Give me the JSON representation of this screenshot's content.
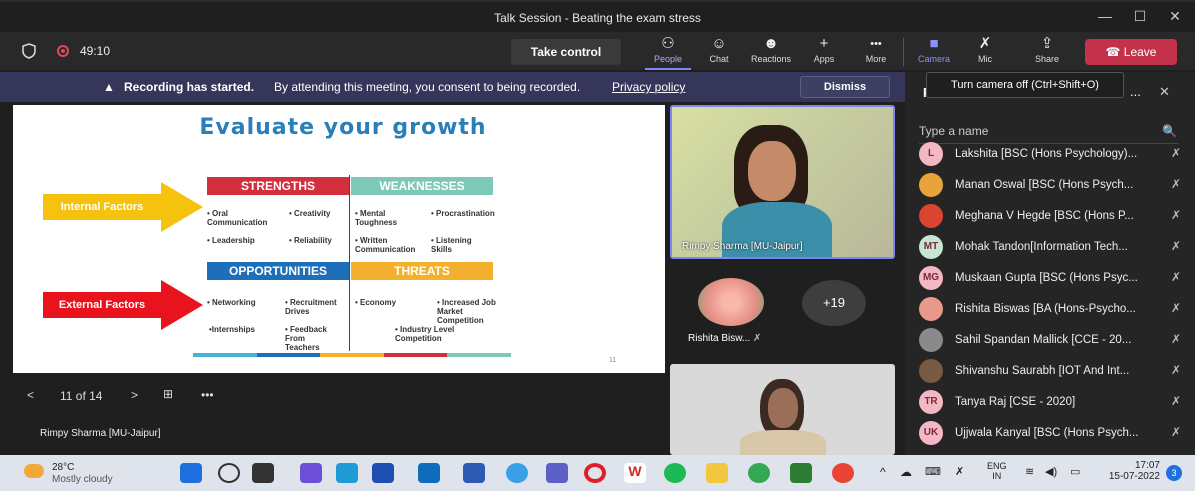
{
  "window": {
    "title": "Talk Session - Beating the exam stress",
    "min": "—",
    "max": "☐",
    "close": "✕"
  },
  "toolbar": {
    "timer": "49:10",
    "take_control": "Take control",
    "items": [
      {
        "label": "People",
        "icon": "people-icon",
        "glyph": "⚇"
      },
      {
        "label": "Chat",
        "icon": "chat-icon",
        "glyph": "☺"
      },
      {
        "label": "Reactions",
        "icon": "reactions-icon",
        "glyph": "☻"
      },
      {
        "label": "Apps",
        "icon": "apps-icon",
        "glyph": "+"
      },
      {
        "label": "More",
        "icon": "more-icon",
        "glyph": "•••"
      },
      {
        "label": "Camera",
        "icon": "camera-icon",
        "glyph": "■"
      },
      {
        "label": "Mic",
        "icon": "mic-off-icon",
        "glyph": "✗"
      },
      {
        "label": "Share",
        "icon": "share-icon",
        "glyph": "⇪"
      }
    ],
    "leave": "Leave",
    "camera_tooltip": "Turn camera off (Ctrl+Shift+O)"
  },
  "banner": {
    "bold": "Recording has started.",
    "text": "By attending this meeting, you consent to being recorded.",
    "link": "Privacy policy",
    "dismiss": "Dismiss"
  },
  "slide": {
    "title": "Evaluate your growth",
    "internal": "Internal Factors",
    "external": "External Factors",
    "strengths": "STRENGTHS",
    "weaknesses": "WEAKNESSES",
    "opportunities": "OPPORTUNITIES",
    "threats": "THREATS",
    "s1": "• Oral\nCommunication",
    "s2": "• Creativity",
    "s3": "• Leadership",
    "s4": "• Reliability",
    "w1": "• Mental\nToughness",
    "w2": "• Procrastination",
    "w3": "• Written\nCommunication",
    "w4": "• Listening\nSkills",
    "o1": "• Networking",
    "o2": "• Recruitment\nDrives",
    "o3": "•Internships",
    "o4": "• Feedback\nFrom\nTeachers",
    "t1": "• Economy",
    "t2": "• Increased Job\nMarket\nCompetition",
    "t3": "• Industry Level\nCompetition",
    "page_no": "11",
    "colors": {
      "strengths": "#d32f3c",
      "weaknesses": "#7ec8b8",
      "opportunities": "#1e6fb8",
      "threats": "#f2b02d"
    }
  },
  "slide_nav": {
    "counter": "11 of 14",
    "prev": "<",
    "next": ">",
    "more": "•••",
    "presenter": "Rimpy Sharma [MU-Jaipur]"
  },
  "videos": {
    "main_name": "Rimpy Sharma [MU-Jaipur]",
    "rishita": "Rishita Bisw...",
    "overflow": "+19"
  },
  "panel": {
    "header_initial": "P",
    "more": "...",
    "close": "✕",
    "search_placeholder": "Type a name",
    "participants": [
      {
        "name": "Lakshita [BSC (Hons Psychology)...",
        "initials": "L",
        "color": "#f4b8c4"
      },
      {
        "name": "Manan Oswal [BSC (Hons Psych...",
        "initials": "",
        "color": "#e8a43a"
      },
      {
        "name": "Meghana V Hegde [BSC (Hons P...",
        "initials": "",
        "color": "#d9452f"
      },
      {
        "name": "Mohak Tandon[Information Tech...",
        "initials": "MT",
        "color": "#c7e6d2"
      },
      {
        "name": "Muskaan Gupta [BSC (Hons Psyc...",
        "initials": "MG",
        "color": "#f4b8c4"
      },
      {
        "name": "Rishita Biswas [BA (Hons-Psycho...",
        "initials": "",
        "color": "#e89a8a"
      },
      {
        "name": "Sahil Spandan Mallick [CCE - 20...",
        "initials": "",
        "color": "#8a8a8a"
      },
      {
        "name": "Shivanshu Saurabh [IOT And Int...",
        "initials": "",
        "color": "#7a5a40"
      },
      {
        "name": "Tanya Raj [CSE - 2020]",
        "initials": "TR",
        "color": "#f4b8c4"
      },
      {
        "name": "Ujjwala Kanyal [BSC (Hons Psych...",
        "initials": "UK",
        "color": "#f4b8c4"
      }
    ]
  },
  "taskbar": {
    "temp": "28°C",
    "weather": "Mostly cloudy",
    "lang1": "ENG",
    "lang2": "IN",
    "time": "17:07",
    "date": "15-07-2022",
    "badge": "3"
  }
}
